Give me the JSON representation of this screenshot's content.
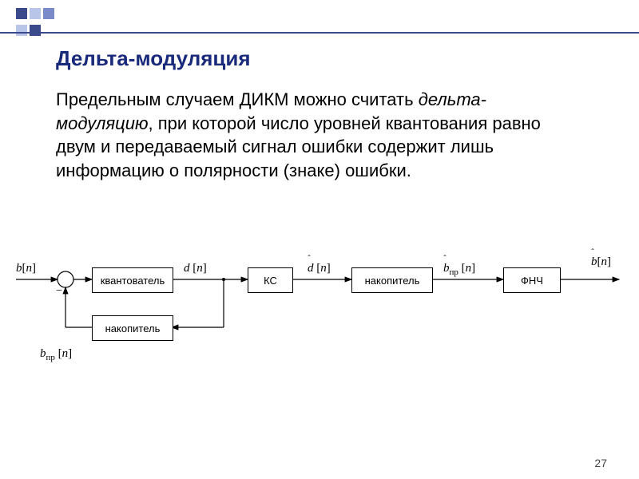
{
  "title": "Дельта-модуляция",
  "paragraph_pre": "Предельным случаем ДИКМ можно считать ",
  "paragraph_em": "дельта-модуляцию",
  "paragraph_post": ", при которой число уровней квантования равно двум и передаваемый сигнал ошибки содержит лишь информацию о полярности (знаке) ошибки.",
  "page_number": "27",
  "blocks": {
    "quantizer": "квантователь",
    "accumulator1": "накопитель",
    "channel": "КС",
    "accumulator2": "накопитель",
    "lpf": "ФНЧ"
  },
  "signals": {
    "b_n": "b[n]",
    "d_n": "d [n]",
    "d_hat_n": "d̂ [n]",
    "b_pr_hat_n": "b̂пр [n]",
    "b_hat_n": "b̂[n]",
    "b_pr_n": "bпр [n]"
  },
  "chart_data": {
    "type": "block-diagram",
    "title": "Дельта-модуляция (delta modulation encoder/decoder)",
    "nodes": [
      {
        "id": "in",
        "type": "input",
        "label": "b[n]"
      },
      {
        "id": "sum",
        "type": "summer",
        "inputs": [
          "+b[n]",
          "-bпр[n]"
        ]
      },
      {
        "id": "quant",
        "type": "block",
        "label": "квантователь"
      },
      {
        "id": "acc1",
        "type": "block",
        "label": "накопитель"
      },
      {
        "id": "ks",
        "type": "block",
        "label": "КС"
      },
      {
        "id": "acc2",
        "type": "block",
        "label": "накопитель"
      },
      {
        "id": "lpf",
        "type": "block",
        "label": "ФНЧ"
      },
      {
        "id": "out",
        "type": "output",
        "label": "b̂[n]"
      }
    ],
    "edges": [
      {
        "from": "in",
        "to": "sum",
        "label": "b[n]"
      },
      {
        "from": "sum",
        "to": "quant"
      },
      {
        "from": "quant",
        "to": "ks",
        "label": "d[n]"
      },
      {
        "from": "quant",
        "to": "acc1",
        "feedback": true
      },
      {
        "from": "acc1",
        "to": "sum",
        "label": "bпр[n]",
        "sign": "-"
      },
      {
        "from": "ks",
        "to": "acc2",
        "label": "d̂[n]"
      },
      {
        "from": "acc2",
        "to": "lpf",
        "label": "b̂пр[n]"
      },
      {
        "from": "lpf",
        "to": "out",
        "label": "b̂[n]"
      }
    ]
  }
}
